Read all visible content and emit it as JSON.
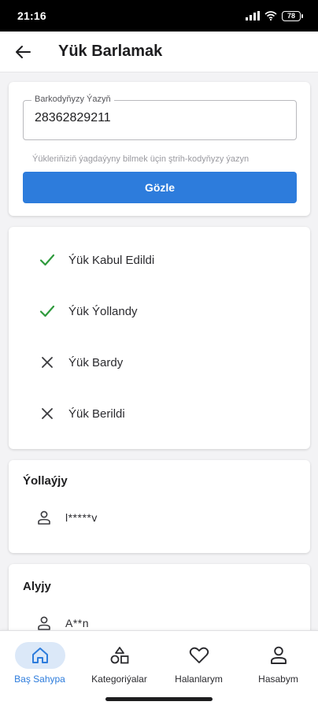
{
  "status_bar": {
    "time": "21:16",
    "battery": "78"
  },
  "app_bar": {
    "title": "Yük Barlamak",
    "back_icon": "arrow-left-icon"
  },
  "search": {
    "field_label": "Barkodyňyzy Ýazyň",
    "value": "28362829211",
    "helper": "Ýükleriňiziň ýagdaýyny bilmek üçin ştrih-kodyňyzy ýazyn",
    "button_label": "Gözle",
    "accent": "#2d7cdc"
  },
  "statuses": [
    {
      "label": "Ýük Kabul Edildi",
      "done": true,
      "icon": "check-icon"
    },
    {
      "label": "Ýük Ýollandy",
      "done": true,
      "icon": "check-icon"
    },
    {
      "label": "Ýük Bardy",
      "done": false,
      "icon": "close-icon"
    },
    {
      "label": "Ýük Berildi",
      "done": false,
      "icon": "close-icon"
    }
  ],
  "status_colors": {
    "done": "#2e9a3c",
    "pending": "#3a3a3e"
  },
  "sender": {
    "title": "Ýollaýjy",
    "name": "l*****v",
    "icon": "person-icon"
  },
  "receiver": {
    "title": "Alyjy",
    "name": "A**n",
    "icon": "person-icon"
  },
  "bottom_nav": [
    {
      "label": "Baş Sahypa",
      "icon": "home-icon",
      "active": true
    },
    {
      "label": "Kategoriýalar",
      "icon": "categories-icon",
      "active": false
    },
    {
      "label": "Halanlarym",
      "icon": "heart-icon",
      "active": false
    },
    {
      "label": "Hasabym",
      "icon": "person-icon",
      "active": false
    }
  ]
}
